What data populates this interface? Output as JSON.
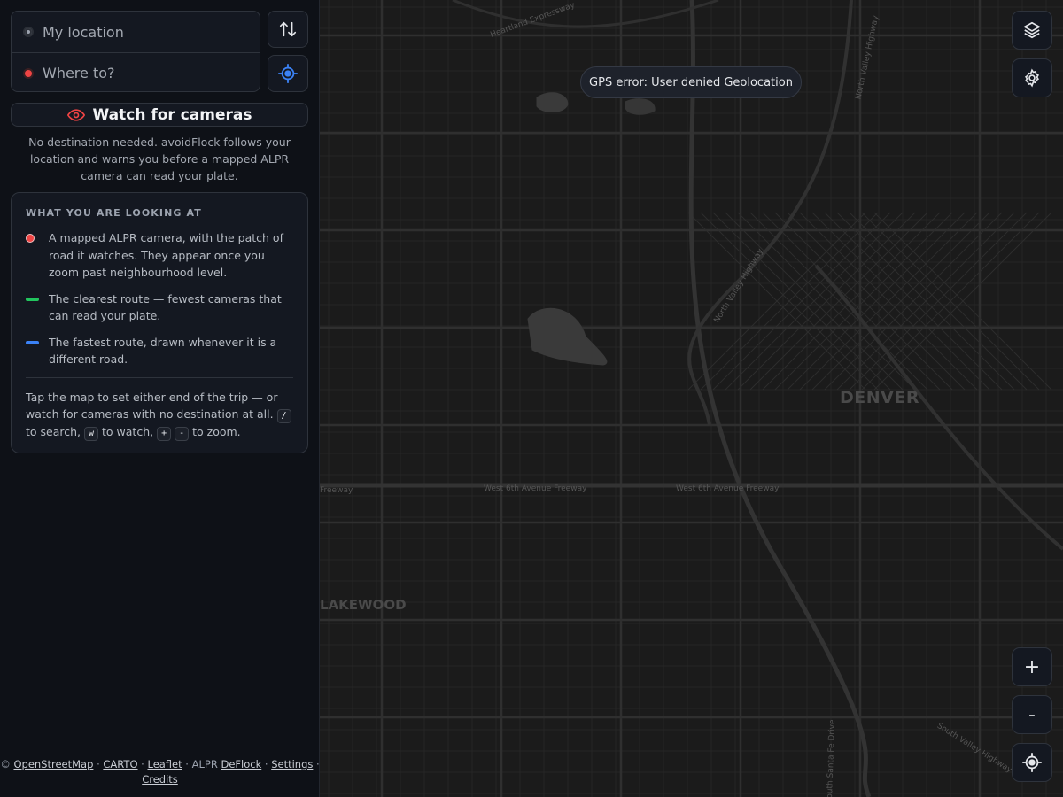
{
  "route": {
    "origin_placeholder": "My location",
    "destination_placeholder": "Where to?"
  },
  "watch": {
    "label": "Watch for cameras",
    "description": "No destination needed. avoidFlock follows your location and warns you before a mapped ALPR camera can read your plate."
  },
  "legend": {
    "title": "WHAT YOU ARE LOOKING AT",
    "items": [
      {
        "text": "A mapped ALPR camera, with the patch of road it watches. They appear once you zoom past neighbourhood level.",
        "color": "#ef4444"
      },
      {
        "text": "The clearest route — fewest cameras that can read your plate.",
        "color": "#22c55e"
      },
      {
        "text": "The fastest route, drawn whenever it is a different road.",
        "color": "#3b82f6"
      }
    ],
    "help": {
      "part1": "Tap the map to set either end of the trip — or watch for cameras with no destination at all.",
      "key_search": "/",
      "part2": "to search,",
      "key_watch": "w",
      "part3": "to watch,",
      "key_zoom_in": "+",
      "key_zoom_out": "-",
      "part4": "to zoom."
    }
  },
  "footer": {
    "copyright": "©",
    "osm": "OpenStreetMap",
    "carto": "CARTO",
    "leaflet": "Leaflet",
    "alpr": "ALPR",
    "deflock": "DeFlock",
    "settings": "Settings",
    "credits": "Credits",
    "sep": "·"
  },
  "map": {
    "toast": "GPS error: User denied Geolocation",
    "city_labels": [
      "DENVER",
      "LAKEWOOD"
    ],
    "road_labels": [
      "Heartland Expressway",
      "North Valley Highway",
      "West 6th Avenue Freeway",
      "West 6th Avenue Freeway",
      "Freeway",
      "South Valley Highway",
      "North Valley Highway",
      "South Santa Fe Drive"
    ],
    "controls": {
      "zoom_in": "+",
      "zoom_out": "-"
    }
  },
  "colors": {
    "camera": "#ef4444",
    "clearest_route": "#22c55e",
    "fastest_route": "#3b82f6",
    "locate_icon": "#3b82f6"
  }
}
